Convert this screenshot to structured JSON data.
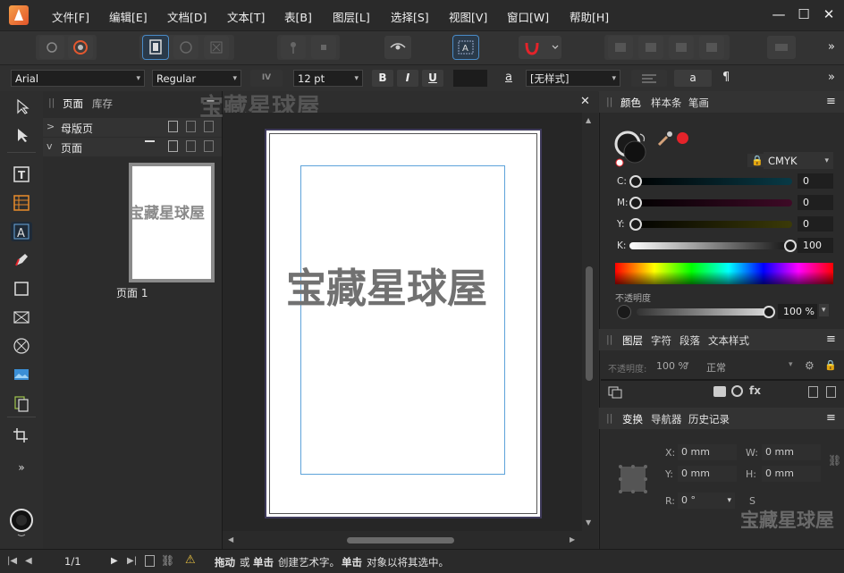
{
  "menu": [
    "文件[F]",
    "编辑[E]",
    "文档[D]",
    "文本[T]",
    "表[B]",
    "图层[L]",
    "选择[S]",
    "视图[V]",
    "窗口[W]",
    "帮助[H]"
  ],
  "window_controls": {
    "minimize": "—",
    "maximize": "☐",
    "close": "✕"
  },
  "context_toolbar": {
    "font_family": "Arial",
    "font_style": "Regular",
    "tracking_icon": "IV",
    "font_size": "12 pt",
    "bold": "B",
    "italic": "I",
    "underline": "U",
    "char_style_icon": "a",
    "paragraph_style": "[无样式]",
    "a_button": "a",
    "pilcrow": "¶",
    "more": "»"
  },
  "pages_panel": {
    "tabs": [
      "页面",
      "库存"
    ],
    "master_row": "母版页",
    "pages_row": "页面",
    "thumbnail_caption": "页面 1",
    "thumbnail_watermark": "宝藏星球屋"
  },
  "canvas": {
    "watermark": "宝藏星球屋",
    "top_watermark": "宝藏星球屋"
  },
  "color_panel": {
    "tabs": [
      "颜色",
      "样本条",
      "笔画"
    ],
    "model": "CMYK",
    "channels": [
      {
        "label": "C:",
        "value": "0"
      },
      {
        "label": "M:",
        "value": "0"
      },
      {
        "label": "Y:",
        "value": "0"
      },
      {
        "label": "K:",
        "value": "100"
      }
    ],
    "opacity_label": "不透明度",
    "opacity_value": "100 %",
    "accent": "#e4232a"
  },
  "layers_panel": {
    "tabs": [
      "图层",
      "字符",
      "段落",
      "文本样式"
    ],
    "opacity_label": "不透明度:",
    "opacity_value": "100 %",
    "blend_mode": "正常"
  },
  "transform_panel": {
    "tabs": [
      "变换",
      "导航器",
      "历史记录"
    ],
    "x_label": "X:",
    "x_value": "0 mm",
    "y_label": "Y:",
    "y_value": "0 mm",
    "w_label": "W:",
    "w_value": "0 mm",
    "h_label": "H:",
    "h_value": "0 mm",
    "r_label": "R:",
    "r_value": "0 °",
    "s_label": "S"
  },
  "status_bar": {
    "page_indicator": "1/1",
    "drag_bold": "拖动",
    "or": "或",
    "click_bold": "单击",
    "create_text": "创建艺术字。",
    "click_bold2": "单击",
    "select_text": "对象以将其选中。"
  },
  "watermark_corner": "宝藏星球屋"
}
